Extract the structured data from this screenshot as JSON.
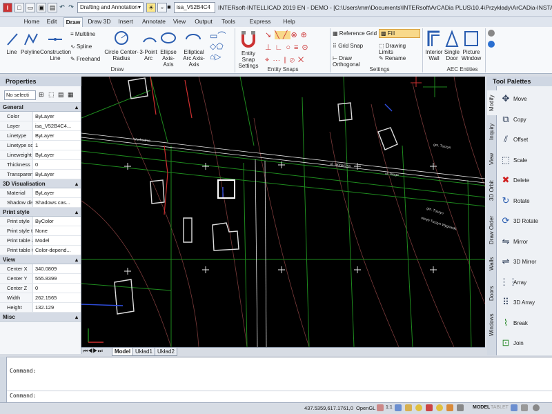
{
  "titlebar": {
    "workspace": "Drafting and Annotation",
    "layer": "isa_V52B4C4",
    "title": "INTERsoft-INTELLICAD 2019 EN - DEMO - [C:\\Users\\mm\\Documents\\INTERsoft\\ArCADia PLUS\\10.4\\Przykłady\\ArCADia-INSTALAC..."
  },
  "tabs": [
    "Home",
    "Edit",
    "Draw",
    "Draw 3D",
    "Insert",
    "Annotate",
    "View",
    "Output",
    "Tools",
    "Express Tools",
    "Help"
  ],
  "active_tab": "Draw",
  "ribbon": {
    "draw": {
      "line": "Line",
      "polyline": "Polyline",
      "construction_line": "Construction Line",
      "multiline": "Multiline",
      "spline": "Spline",
      "freehand": "Freehand",
      "circle": "Circle Center-Radius",
      "arc": "3-Point Arc",
      "ellipse": "Ellipse Axis-Axis",
      "elliptical_arc": "Elliptical Arc Axis-Axis",
      "group": "Draw"
    },
    "entity_snaps": {
      "settings": "Entity Snap Settings",
      "group": "Entity Snaps"
    },
    "settings": {
      "reference_grid": "Reference Grid",
      "grid_snap": "Grid Snap",
      "draw_orthogonal": "Draw Orthogonal",
      "fill": "Fill",
      "drawing_limits": "Drawing Limits",
      "rename": "Rename",
      "group": "Settings"
    },
    "aec": {
      "interior_wall": "Interior Wall",
      "single_door": "Single Door",
      "picture_window": "Picture Window",
      "group": "AEC Entities"
    }
  },
  "properties": {
    "title": "Properties",
    "selection": "No selecti",
    "sections": [
      {
        "name": "General",
        "rows": [
          {
            "k": "Color",
            "v": "ByLayer"
          },
          {
            "k": "Layer",
            "v": "isa_V52B4C4..."
          },
          {
            "k": "Linetype",
            "v": "ByLayer"
          },
          {
            "k": "Linetype scale",
            "v": "1"
          },
          {
            "k": "Lineweight",
            "v": "ByLayer"
          },
          {
            "k": "Thickness",
            "v": "0"
          },
          {
            "k": "Transparency",
            "v": "ByLayer"
          }
        ]
      },
      {
        "name": "3D Visualisation",
        "rows": [
          {
            "k": "Material",
            "v": "ByLayer"
          },
          {
            "k": "Shadow displ",
            "v": "Shadows cas..."
          }
        ]
      },
      {
        "name": "Print style",
        "rows": [
          {
            "k": "Print style",
            "v": "ByColor"
          },
          {
            "k": "Print style table",
            "v": "None"
          },
          {
            "k": "Print table att...",
            "v": "Model"
          },
          {
            "k": "Print table type",
            "v": "Color-depend..."
          }
        ]
      },
      {
        "name": "View",
        "rows": [
          {
            "k": "Center X",
            "v": "340.0809"
          },
          {
            "k": "Center Y",
            "v": "555.8399"
          },
          {
            "k": "Center Z",
            "v": "0"
          },
          {
            "k": "Width",
            "v": "262.1565"
          },
          {
            "k": "Height",
            "v": "132.129"
          }
        ]
      },
      {
        "name": "Misc",
        "rows": []
      }
    ]
  },
  "drawing": {
    "labels": [
      "Wschodnia",
      "ul. Słoneczna",
      "gm. Tuszyn",
      "obręb Tuszyn Wygnanki",
      "ul. Długa",
      "gm. Tuszyn"
    ]
  },
  "layout_tabs": [
    "Model",
    "Układ1",
    "Układ2"
  ],
  "tool_palettes": {
    "title": "Tool Palettes",
    "side_tabs": [
      "Modify",
      "Inquiry",
      "View",
      "3D Orbit",
      "Draw Order",
      "Walls",
      "Doors",
      "Windows"
    ],
    "tools": [
      "Move",
      "Copy",
      "Offset",
      "Scale",
      "Delete",
      "Rotate",
      "3D Rotate",
      "Mirror",
      "3D Mirror",
      "Array",
      "3D Array",
      "Break",
      "Join"
    ]
  },
  "command": {
    "history": "Command:",
    "prompt": "Command:"
  },
  "status": {
    "coords": "437.5359,617.1761,0",
    "opengl": "OpenGL",
    "scale": "1:1",
    "model": "MODEL",
    "tablet": "TABLET"
  },
  "colors": {
    "accent": "#3a6fc4",
    "canvas": "#000000",
    "ribbon": "#f7f9fb"
  }
}
